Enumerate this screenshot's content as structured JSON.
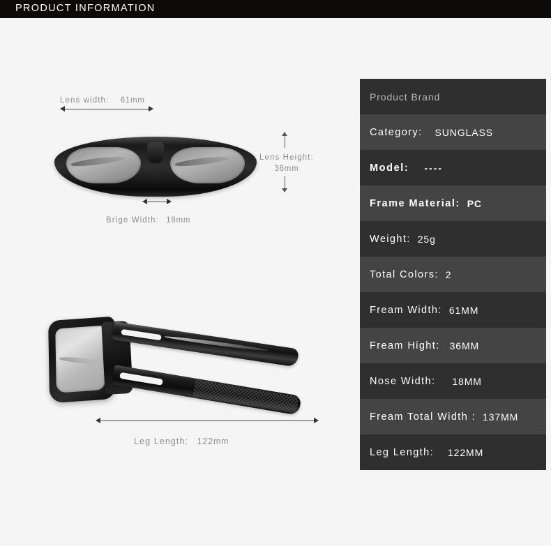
{
  "header": {
    "title": "PRODUCT INFORMATION"
  },
  "diagram": {
    "lens_width": {
      "label": "Lens width:",
      "value": "61mm"
    },
    "lens_height": {
      "label": "Lens Height:",
      "value": "36mm"
    },
    "bridge_width": {
      "label": "Brige Width:",
      "value": "18mm"
    },
    "leg_length": {
      "label": "Leg Length:",
      "value": "122mm"
    }
  },
  "spec_table": {
    "rows": [
      {
        "key": "Product Brand",
        "value": ""
      },
      {
        "key": "Category:",
        "value": "SUNGLASS"
      },
      {
        "key": "Model:",
        "value": "----"
      },
      {
        "key": "Frame Material:",
        "value": "PC"
      },
      {
        "key": "Weight:",
        "value": "25g"
      },
      {
        "key": "Total Colors:",
        "value": "2"
      },
      {
        "key": "Fream Width:",
        "value": "61MM"
      },
      {
        "key": "Fream Hight:",
        "value": "36MM"
      },
      {
        "key": "Nose Width:",
        "value": "18MM"
      },
      {
        "key": "Fream Total Width :",
        "value": "137MM"
      },
      {
        "key": "Leg Length:",
        "value": "122MM"
      }
    ]
  },
  "colors": {
    "header_bg": "#0d0a0a",
    "page_bg": "#f5f5f5",
    "row_dark": "#2f2f2f",
    "row_light": "#444444",
    "dim_text": "#8d8d8d"
  }
}
